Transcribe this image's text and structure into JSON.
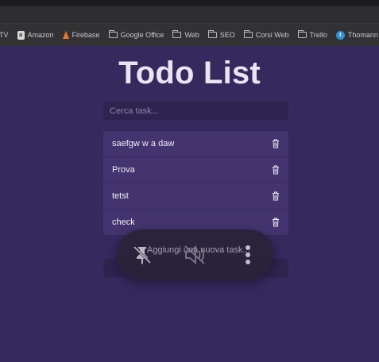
{
  "bookmarks": [
    {
      "label": "TV",
      "icon": "none"
    },
    {
      "label": "Amazon",
      "icon": "amazon-icon"
    },
    {
      "label": "Firebase",
      "icon": "firebase-icon"
    },
    {
      "label": "Google Office",
      "icon": "folder-icon"
    },
    {
      "label": "Web",
      "icon": "folder-icon"
    },
    {
      "label": "SEO",
      "icon": "folder-icon"
    },
    {
      "label": "Corsi Web",
      "icon": "folder-icon"
    },
    {
      "label": "Trello",
      "icon": "folder-icon"
    },
    {
      "label": "Thomann",
      "icon": "thomann-icon"
    }
  ],
  "app": {
    "title": "Todo List",
    "search_placeholder": "Cerca task...",
    "tasks": [
      {
        "text": "saefgw w a daw"
      },
      {
        "text": "Prova"
      },
      {
        "text": "tetst"
      },
      {
        "text": "check"
      }
    ],
    "add_placeholder": "Aggiungi una nuova task..."
  },
  "overlay": {
    "buttons": [
      "unpin-icon",
      "mute-icon",
      "more-vertical-icon"
    ]
  },
  "colors": {
    "background": "#36295e",
    "list_background": "#43346f",
    "input_background": "#2e2450",
    "title_text": "#e9e5f4"
  }
}
